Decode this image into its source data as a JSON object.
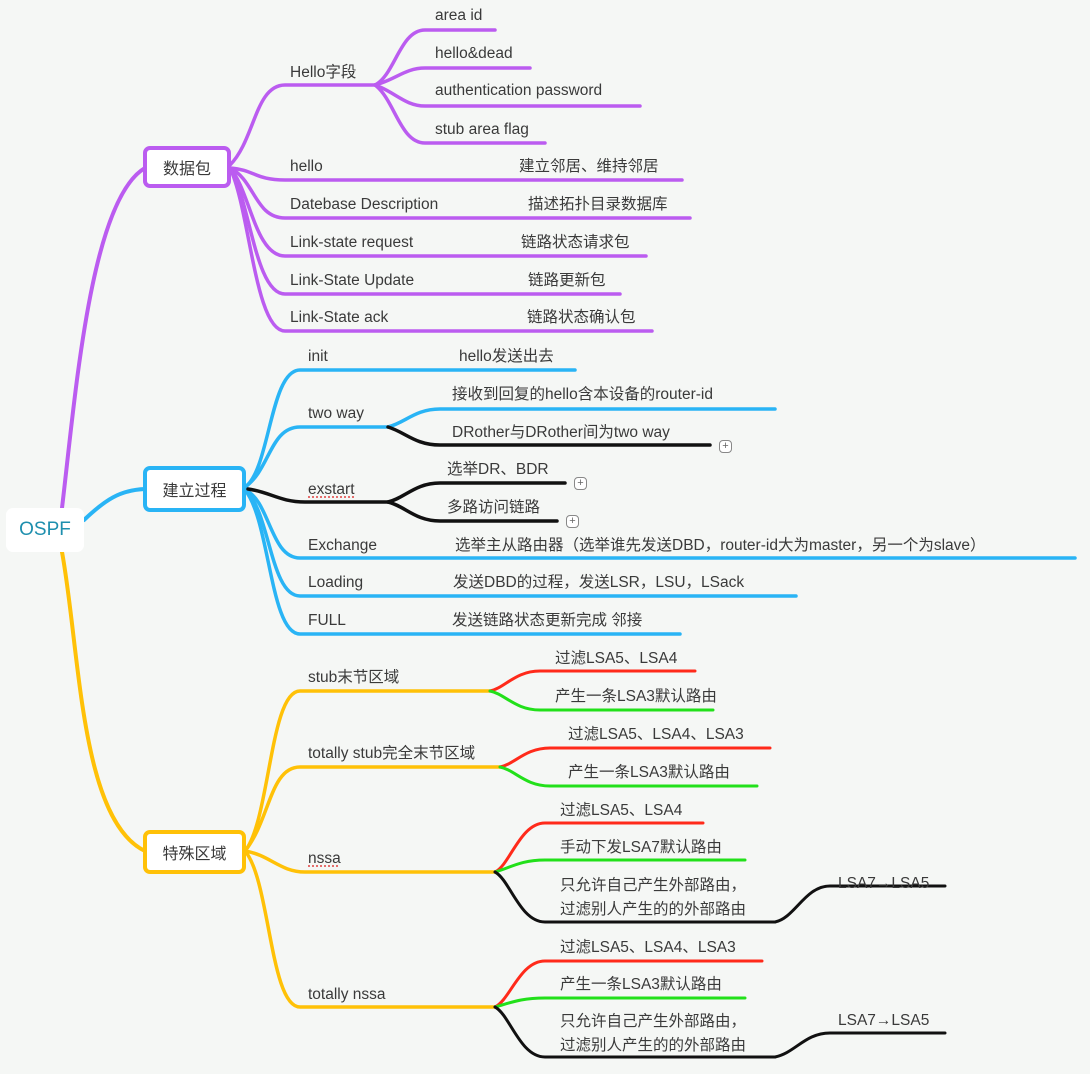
{
  "root": {
    "label": "OSPF"
  },
  "colors": {
    "packets": "#bb5cf0",
    "process": "#29b4f5",
    "areas": "#ffc107",
    "red": "#ff2a1a",
    "green": "#22e01a",
    "black": "#111111",
    "root_text": "#1e8fae"
  },
  "packets": {
    "label": "数据包",
    "hello_fields": {
      "label": "Hello字段",
      "children": [
        "area id",
        "hello&dead",
        "authentication password",
        "stub area flag"
      ]
    },
    "items": [
      {
        "label": "hello",
        "desc": "建立邻居、维持邻居"
      },
      {
        "label": "Datebase Description",
        "desc": "描述拓扑目录数据库"
      },
      {
        "label": "Link-state request",
        "desc": "链路状态请求包"
      },
      {
        "label": "Link-State Update",
        "desc": "链路更新包"
      },
      {
        "label": "Link-State ack",
        "desc": "链路状态确认包"
      }
    ]
  },
  "process": {
    "label": "建立过程",
    "init": {
      "label": "init",
      "desc": "hello发送出去"
    },
    "two_way": {
      "label": "two way",
      "children": [
        "接收到回复的hello含本设备的router-id",
        "DRother与DRother间为two way"
      ]
    },
    "exstart": {
      "label": "exstart",
      "children": [
        "选举DR、BDR",
        "多路访问链路"
      ]
    },
    "exchange": {
      "label": "Exchange",
      "desc": "选举主从路由器（选举谁先发送DBD，router-id大为master，另一个为slave）"
    },
    "loading": {
      "label": "Loading",
      "desc": "发送DBD的过程，发送LSR，LSU，LSack"
    },
    "full": {
      "label": "FULL",
      "desc": "发送链路状态更新完成   邻接"
    }
  },
  "areas": {
    "label": "特殊区域",
    "stub": {
      "label": "stub末节区域",
      "children": [
        "过滤LSA5、LSA4",
        "产生一条LSA3默认路由"
      ]
    },
    "totally_stub": {
      "label": "totally stub完全末节区域",
      "children": [
        "过滤LSA5、LSA4、LSA3",
        "产生一条LSA3默认路由"
      ]
    },
    "nssa": {
      "label": "nssa",
      "children": [
        "过滤LSA5、LSA4",
        "手动下发LSA7默认路由",
        "只允许自己产生外部路由，\n过滤别人产生的的外部路由"
      ],
      "sub": "LSA7→LSA5"
    },
    "totally_nssa": {
      "label": "totally nssa",
      "children": [
        "过滤LSA5、LSA4、LSA3",
        "产生一条LSA3默认路由",
        "只允许自己产生外部路由，\n过滤别人产生的的外部路由"
      ],
      "sub": "LSA7→LSA5"
    }
  },
  "expand_symbol": "+"
}
